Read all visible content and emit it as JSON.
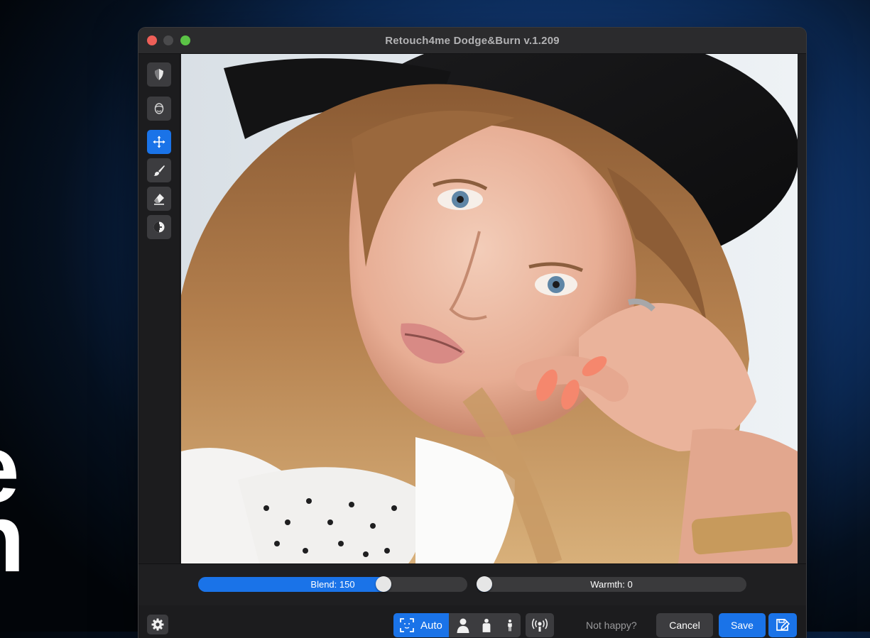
{
  "background_text": {
    "line1": "e",
    "line2": "n"
  },
  "window": {
    "title": "Retouch4me Dodge&Burn v.1.209"
  },
  "tools": [
    {
      "icon": "shield-icon"
    },
    {
      "icon": "face-icon"
    },
    {
      "icon": "move-icon",
      "active": true
    },
    {
      "icon": "brush-icon"
    },
    {
      "icon": "eraser-icon"
    },
    {
      "icon": "contrast-icon"
    }
  ],
  "sliders": {
    "blend": {
      "label": "Blend: 150",
      "fraction": 0.7
    },
    "warmth": {
      "label": "Warmth: 0",
      "fraction": 0.0
    }
  },
  "bottom": {
    "auto_label": "Auto",
    "not_happy": "Not happy?",
    "cancel": "Cancel",
    "save": "Save"
  },
  "colors": {
    "accent": "#1a73e8",
    "window_bg": "#202022",
    "button_bg": "#3c3c3f"
  }
}
